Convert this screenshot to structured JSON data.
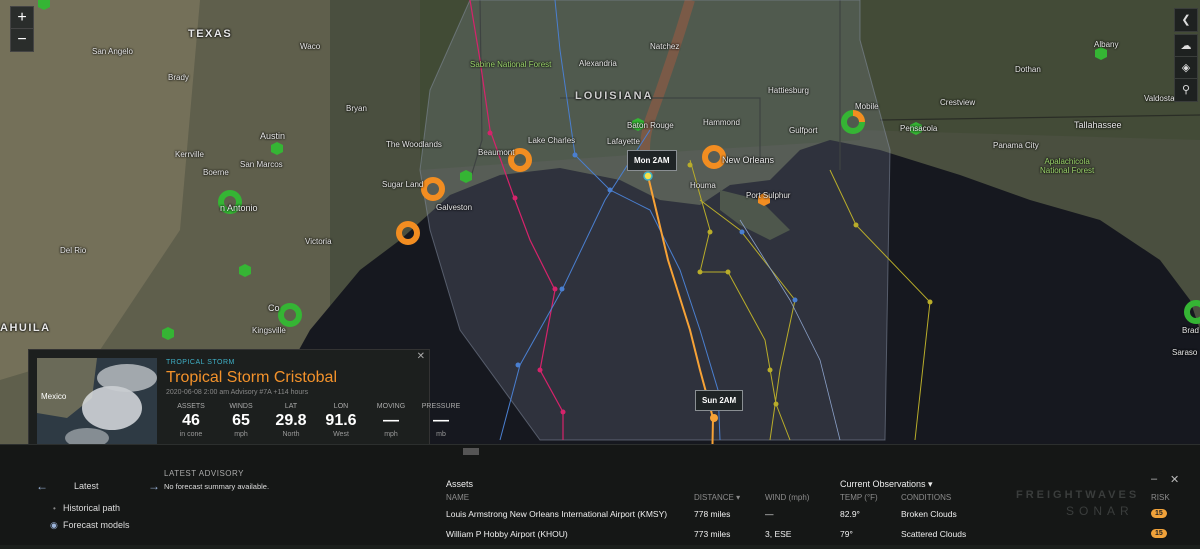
{
  "map": {
    "labels": {
      "state_tx": "TEXAS",
      "state_la": "LOUISIANA",
      "coahuila": "AHUILA",
      "austin": "Austin",
      "san_antonio": "n Antonio",
      "san_marcos": "San Marcos",
      "sugarland": "Sugar Land",
      "galveston": "Galveston",
      "victoria": "Victoria",
      "kingsville": "Kingsville",
      "corpus": "Co",
      "beaumont": "Beaumont",
      "lake_charles": "Lake Charles",
      "lafayette": "Lafayette",
      "baton_rouge": "Baton Rouge",
      "new_orleans": "New Orleans",
      "hammond": "Hammond",
      "hattiesburg": "Hattiesburg",
      "gulfport": "Gulfport",
      "mobile": "Mobile",
      "pensacola": "Pensacola",
      "panama_city": "Panama City",
      "tallahassee": "Tallahassee",
      "valdosta": "Valdosta",
      "albany": "Albany",
      "dothan": "Dothan",
      "crestview": "Crestview",
      "alexandria": "Alexandria",
      "natchez": "Natchez",
      "bryan": "Bryan",
      "waco": "Waco",
      "the_woodlands": "The Woodlands",
      "houma": "Houma",
      "port_sulphur": "Port Sulphur",
      "sabine": "Sabine National Forest",
      "apalachicola": "Apalachicola\nNational Forest",
      "kerrville": "Kerrville",
      "boerne": "Boerne",
      "brady": "Brady",
      "san_angelo": "San Angelo",
      "del_rio": "Del Rio",
      "mexico": "Mexico",
      "sarasota": "Saraso",
      "brad": "Brad"
    },
    "callouts": {
      "mon": "Mon 2AM",
      "sun": "Sun 2AM"
    },
    "colors": {
      "forecast_line": "#f7a236",
      "cone": "#8a93a8",
      "asset_orange": "#f28d21",
      "asset_green": "#35b534",
      "track_pink": "#d6236b",
      "track_blue": "#4a7fd0",
      "track_olive": "#b9ad2a"
    }
  },
  "controls": {
    "zoom_in": "+",
    "zoom_out": "−",
    "right": [
      "❮",
      "☁",
      "◈",
      "⚲"
    ]
  },
  "storm": {
    "category": "TROPICAL STORM",
    "name": "Tropical Storm Cristobal",
    "advisory": "2020-06-08 2:00 am Advisory #7A +114 hours",
    "thumb_label": "Mexico",
    "stats": [
      {
        "label": "ASSETS",
        "value": "46",
        "unit": "in cone"
      },
      {
        "label": "WINDS",
        "value": "65",
        "unit": "mph"
      },
      {
        "label": "LAT",
        "value": "29.8",
        "unit": "North"
      },
      {
        "label": "LON",
        "value": "91.6",
        "unit": "West"
      },
      {
        "label": "MOVING",
        "value": "—",
        "unit": "mph"
      },
      {
        "label": "PRESSURE",
        "value": "—",
        "unit": "mb"
      }
    ]
  },
  "bottom": {
    "latest": "Latest",
    "latest_advisory_title": "LATEST ADVISORY",
    "latest_advisory_text": "No forecast summary available.",
    "historical": "Historical path",
    "forecast": "Forecast models",
    "assets_header": "Assets",
    "obs_header": "Current Observations ▾",
    "columns": {
      "name": "NAME",
      "distance": "DISTANCE ▾",
      "wind": "WIND (mph)",
      "temp": "TEMP (°F)",
      "conditions": "CONDITIONS",
      "risk": "RISK"
    },
    "rows": [
      {
        "name": "Louis Armstrong New Orleans International Airport (KMSY)",
        "distance": "778 miles",
        "wind": "—",
        "temp": "82.9°",
        "conditions": "Broken Clouds",
        "risk": "15"
      },
      {
        "name": "William P Hobby Airport (KHOU)",
        "distance": "773 miles",
        "wind": "3, ESE",
        "temp": "79°",
        "conditions": "Scattered Clouds",
        "risk": "15"
      }
    ],
    "watermark1": "FREIGHTWAVES",
    "watermark2": "SONAR",
    "minimize": "–",
    "close": "✕"
  }
}
